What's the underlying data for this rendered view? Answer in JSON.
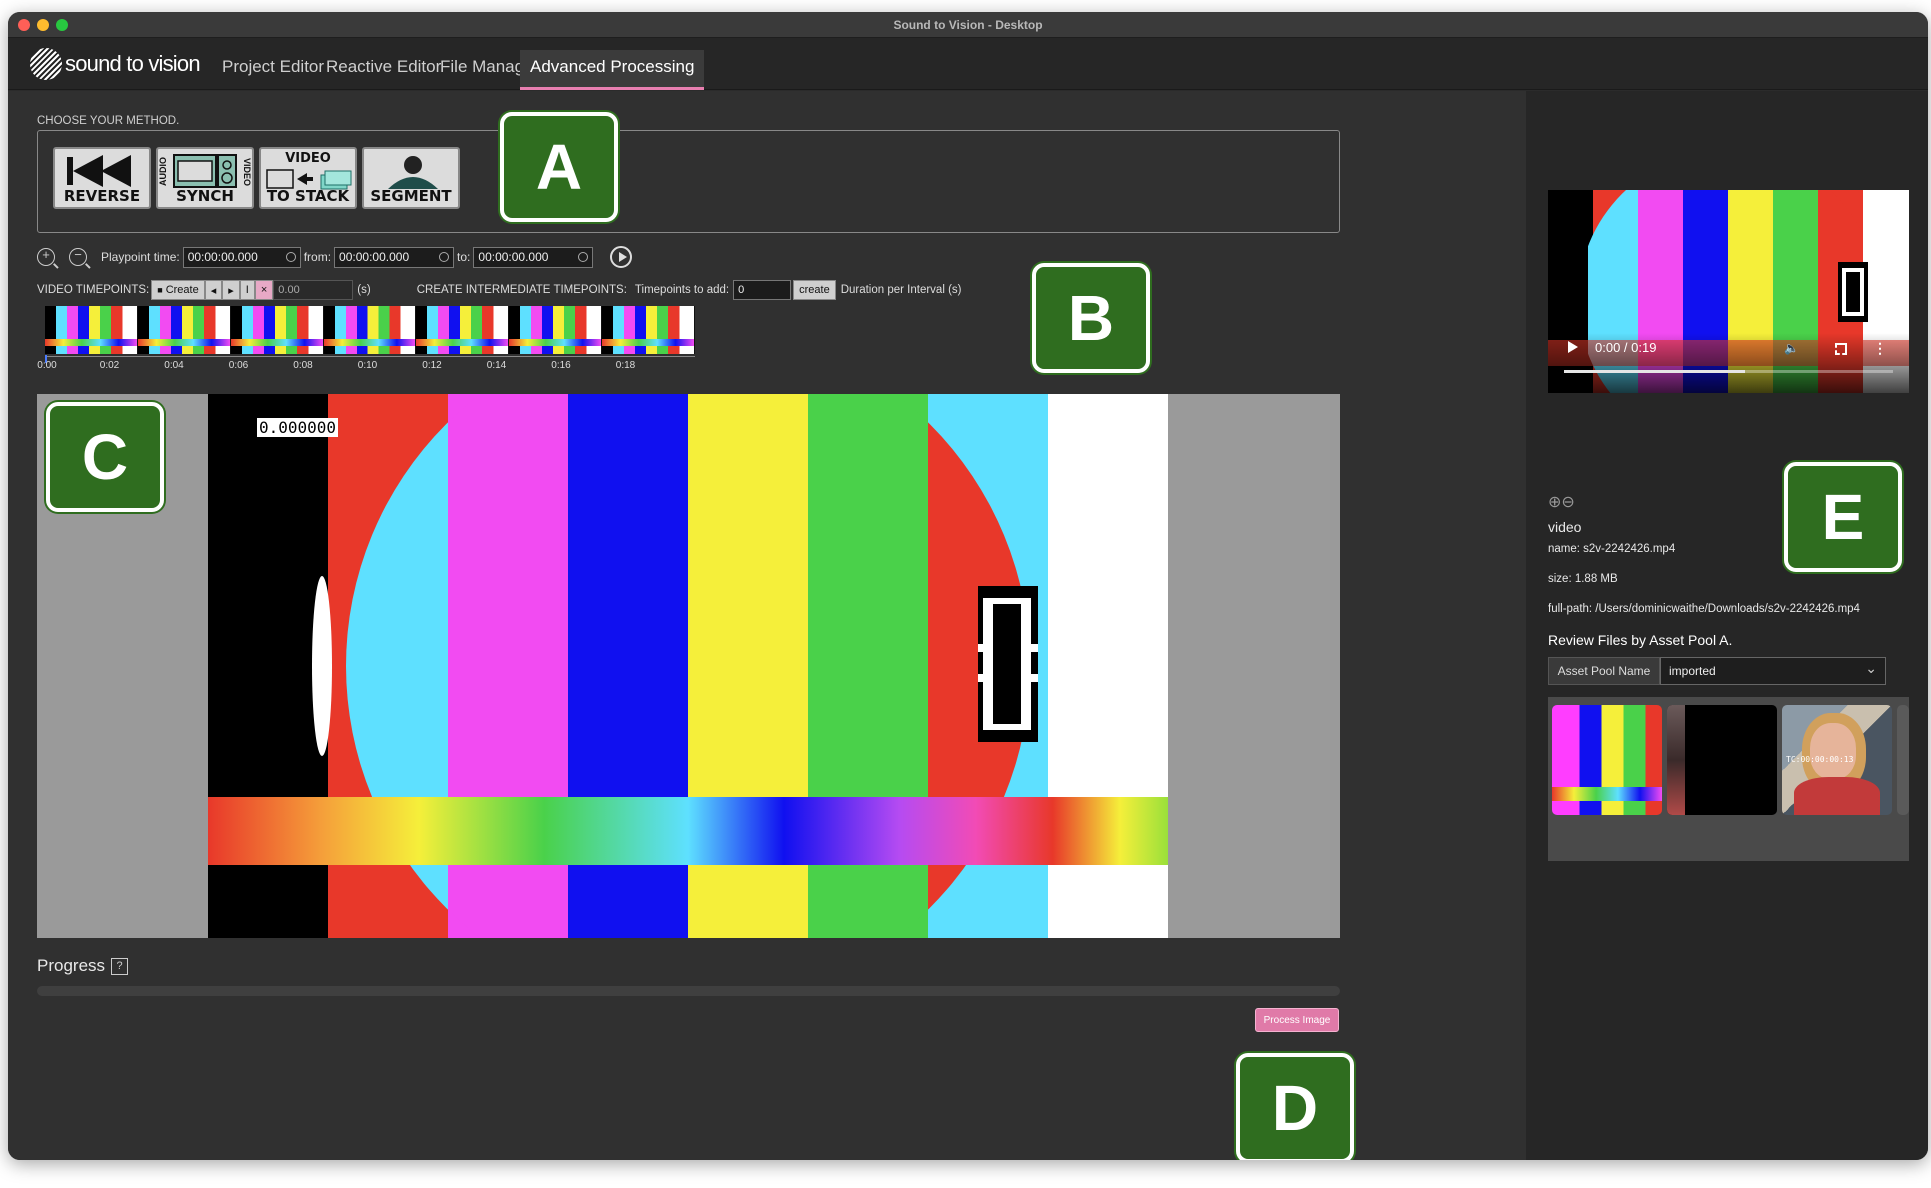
{
  "window": {
    "title": "Sound to Vision - Desktop"
  },
  "app": {
    "logo_text": "sound to vision"
  },
  "tabs": [
    {
      "label": "Project Editor"
    },
    {
      "label": "Reactive Editor"
    },
    {
      "label": "File Manager"
    },
    {
      "label": "Advanced Processing",
      "active": true
    }
  ],
  "method": {
    "label": "CHOOSE YOUR METHOD.",
    "buttons": [
      {
        "caption": "REVERSE",
        "icon": "rewind-icon"
      },
      {
        "caption": "SYNCH",
        "top_left": "AUDIO",
        "top_right": "VIDEO",
        "icon": "audio-video-synch-icon"
      },
      {
        "caption": "TO STACK",
        "top": "VIDEO",
        "icon": "video-to-stack-icon"
      },
      {
        "caption": "SEGMENT",
        "icon": "segment-silhouette-icon"
      }
    ]
  },
  "badges": {
    "a": "A",
    "b": "B",
    "c": "C",
    "d": "D",
    "e": "E"
  },
  "playpoint": {
    "label": "Playpoint time:",
    "value": "00:00:00.000",
    "from_label": "from:",
    "from_value": "00:00:00.000",
    "to_label": "to:",
    "to_value": "00:00:00.000"
  },
  "timepoints": {
    "label": "VIDEO TIMEPOINTS:",
    "create_label": "Create",
    "value": "0.00",
    "unit": "(s)",
    "intermediate_label": "CREATE INTERMEDIATE TIMEPOINTS:",
    "to_add_label": "Timepoints to add:",
    "to_add_value": "0",
    "create_button": "create",
    "duration_label": "Duration per Interval (s)"
  },
  "timeline": {
    "ticks": [
      "0:00",
      "0:02",
      "0:04",
      "0:06",
      "0:08",
      "0:10",
      "0:12",
      "0:14",
      "0:16",
      "0:18"
    ],
    "frame_count": 7
  },
  "stage": {
    "timecode": "0.000000"
  },
  "progress": {
    "label": "Progress",
    "help": "?",
    "value": 0
  },
  "process_button": "Process Image",
  "preview": {
    "time": "0:00 / 0:19",
    "played_fraction": 0.55
  },
  "file_info": {
    "type": "video",
    "name": "name: s2v-2242426.mp4",
    "size": "size: 1.88 MB",
    "full_path": "full-path: /Users/dominicwaithe/Downloads/s2v-2242426.mp4"
  },
  "review": {
    "title": "Review Files by Asset Pool A.",
    "pool_label": "Asset Pool Name",
    "pool_value": "imported",
    "thumb3_overlay": "TC:00:00:00:13"
  },
  "colors": {
    "accent": "#e87fb0",
    "badge_green": "#2f6d1f",
    "bars": [
      "#000000",
      "#5ee0ff",
      "#f24bf2",
      "#1010f0",
      "#f5ef3a",
      "#4ad14a",
      "#e8382a",
      "#ffffff"
    ]
  }
}
